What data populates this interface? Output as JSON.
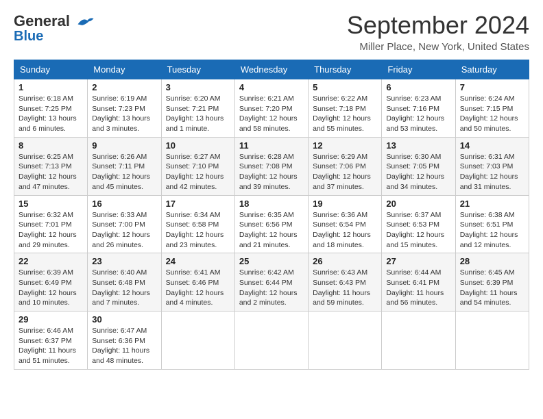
{
  "header": {
    "logo_line1": "General",
    "logo_line2": "Blue",
    "month": "September 2024",
    "location": "Miller Place, New York, United States"
  },
  "days_of_week": [
    "Sunday",
    "Monday",
    "Tuesday",
    "Wednesday",
    "Thursday",
    "Friday",
    "Saturday"
  ],
  "weeks": [
    [
      {
        "day": 1,
        "info": "Sunrise: 6:18 AM\nSunset: 7:25 PM\nDaylight: 13 hours\nand 6 minutes."
      },
      {
        "day": 2,
        "info": "Sunrise: 6:19 AM\nSunset: 7:23 PM\nDaylight: 13 hours\nand 3 minutes."
      },
      {
        "day": 3,
        "info": "Sunrise: 6:20 AM\nSunset: 7:21 PM\nDaylight: 13 hours\nand 1 minute."
      },
      {
        "day": 4,
        "info": "Sunrise: 6:21 AM\nSunset: 7:20 PM\nDaylight: 12 hours\nand 58 minutes."
      },
      {
        "day": 5,
        "info": "Sunrise: 6:22 AM\nSunset: 7:18 PM\nDaylight: 12 hours\nand 55 minutes."
      },
      {
        "day": 6,
        "info": "Sunrise: 6:23 AM\nSunset: 7:16 PM\nDaylight: 12 hours\nand 53 minutes."
      },
      {
        "day": 7,
        "info": "Sunrise: 6:24 AM\nSunset: 7:15 PM\nDaylight: 12 hours\nand 50 minutes."
      }
    ],
    [
      {
        "day": 8,
        "info": "Sunrise: 6:25 AM\nSunset: 7:13 PM\nDaylight: 12 hours\nand 47 minutes."
      },
      {
        "day": 9,
        "info": "Sunrise: 6:26 AM\nSunset: 7:11 PM\nDaylight: 12 hours\nand 45 minutes."
      },
      {
        "day": 10,
        "info": "Sunrise: 6:27 AM\nSunset: 7:10 PM\nDaylight: 12 hours\nand 42 minutes."
      },
      {
        "day": 11,
        "info": "Sunrise: 6:28 AM\nSunset: 7:08 PM\nDaylight: 12 hours\nand 39 minutes."
      },
      {
        "day": 12,
        "info": "Sunrise: 6:29 AM\nSunset: 7:06 PM\nDaylight: 12 hours\nand 37 minutes."
      },
      {
        "day": 13,
        "info": "Sunrise: 6:30 AM\nSunset: 7:05 PM\nDaylight: 12 hours\nand 34 minutes."
      },
      {
        "day": 14,
        "info": "Sunrise: 6:31 AM\nSunset: 7:03 PM\nDaylight: 12 hours\nand 31 minutes."
      }
    ],
    [
      {
        "day": 15,
        "info": "Sunrise: 6:32 AM\nSunset: 7:01 PM\nDaylight: 12 hours\nand 29 minutes."
      },
      {
        "day": 16,
        "info": "Sunrise: 6:33 AM\nSunset: 7:00 PM\nDaylight: 12 hours\nand 26 minutes."
      },
      {
        "day": 17,
        "info": "Sunrise: 6:34 AM\nSunset: 6:58 PM\nDaylight: 12 hours\nand 23 minutes."
      },
      {
        "day": 18,
        "info": "Sunrise: 6:35 AM\nSunset: 6:56 PM\nDaylight: 12 hours\nand 21 minutes."
      },
      {
        "day": 19,
        "info": "Sunrise: 6:36 AM\nSunset: 6:54 PM\nDaylight: 12 hours\nand 18 minutes."
      },
      {
        "day": 20,
        "info": "Sunrise: 6:37 AM\nSunset: 6:53 PM\nDaylight: 12 hours\nand 15 minutes."
      },
      {
        "day": 21,
        "info": "Sunrise: 6:38 AM\nSunset: 6:51 PM\nDaylight: 12 hours\nand 12 minutes."
      }
    ],
    [
      {
        "day": 22,
        "info": "Sunrise: 6:39 AM\nSunset: 6:49 PM\nDaylight: 12 hours\nand 10 minutes."
      },
      {
        "day": 23,
        "info": "Sunrise: 6:40 AM\nSunset: 6:48 PM\nDaylight: 12 hours\nand 7 minutes."
      },
      {
        "day": 24,
        "info": "Sunrise: 6:41 AM\nSunset: 6:46 PM\nDaylight: 12 hours\nand 4 minutes."
      },
      {
        "day": 25,
        "info": "Sunrise: 6:42 AM\nSunset: 6:44 PM\nDaylight: 12 hours\nand 2 minutes."
      },
      {
        "day": 26,
        "info": "Sunrise: 6:43 AM\nSunset: 6:43 PM\nDaylight: 11 hours\nand 59 minutes."
      },
      {
        "day": 27,
        "info": "Sunrise: 6:44 AM\nSunset: 6:41 PM\nDaylight: 11 hours\nand 56 minutes."
      },
      {
        "day": 28,
        "info": "Sunrise: 6:45 AM\nSunset: 6:39 PM\nDaylight: 11 hours\nand 54 minutes."
      }
    ],
    [
      {
        "day": 29,
        "info": "Sunrise: 6:46 AM\nSunset: 6:37 PM\nDaylight: 11 hours\nand 51 minutes."
      },
      {
        "day": 30,
        "info": "Sunrise: 6:47 AM\nSunset: 6:36 PM\nDaylight: 11 hours\nand 48 minutes."
      },
      null,
      null,
      null,
      null,
      null
    ]
  ]
}
